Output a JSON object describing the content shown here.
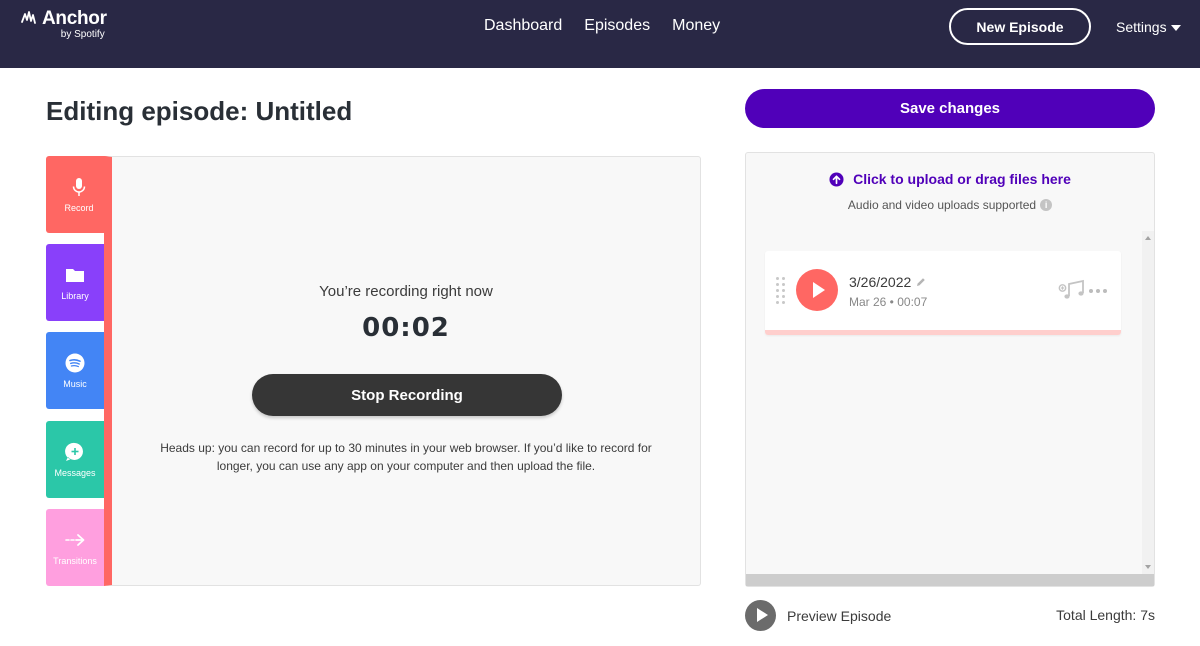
{
  "nav": {
    "logo_text": "Anchor",
    "logo_sub": "by Spotify",
    "links": [
      "Dashboard",
      "Episodes",
      "Money"
    ],
    "new_episode_label": "New Episode",
    "settings_label": "Settings"
  },
  "page": {
    "title": "Editing episode: Untitled"
  },
  "tools": {
    "record": "Record",
    "library": "Library",
    "music": "Music",
    "messages": "Messages",
    "transitions": "Transitions"
  },
  "recording": {
    "status": "You’re recording right now",
    "timer": "00:02",
    "stop_label": "Stop Recording",
    "note": "Heads up: you can record for up to 30 minutes in your web browser. If you’d like to record for longer, you can use any app on your computer and then upload the file."
  },
  "editor": {
    "save_label": "Save changes",
    "upload_label": "Click to upload or drag files here",
    "upload_sub": "Audio and video uploads supported",
    "segments": [
      {
        "title": "3/26/2022",
        "meta": "Mar 26 • 00:07"
      }
    ],
    "preview_label": "Preview Episode",
    "total_length": "Total Length: 7s"
  },
  "colors": {
    "nav_bg": "#292845",
    "accent_purple": "#5000b9",
    "record_red": "#ff6763",
    "library_purple": "#8940fa",
    "music_blue": "#4385f5",
    "messages_teal": "#2bc7a8",
    "transitions_pink": "#ff9fdf"
  }
}
